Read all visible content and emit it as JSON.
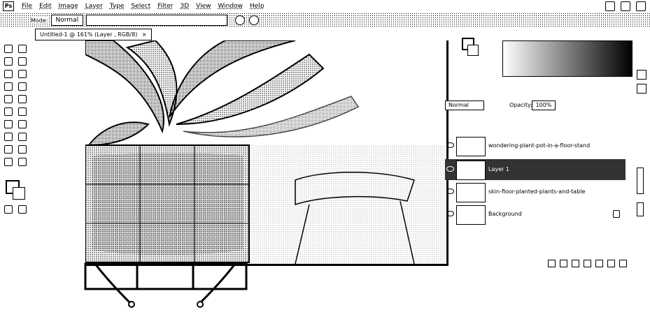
{
  "menubar": {
    "logo": "Ps",
    "items": [
      "File",
      "Edit",
      "Image",
      "Layer",
      "Type",
      "Select",
      "Filter",
      "3D",
      "View",
      "Window",
      "Help"
    ]
  },
  "options": {
    "mode_label": "Mode:",
    "mode_value": "Normal"
  },
  "document": {
    "tab_title": "Untitled-1 @ 161% (Layer , RGB/8)",
    "close": "×"
  },
  "layers": {
    "blend_mode": "Normal",
    "opacity_label": "Opacity:",
    "opacity_value": "100%",
    "items": [
      {
        "name": "wondering-plant-pot-in-a-floor-stand"
      },
      {
        "name": "Layer 1"
      },
      {
        "name": "skin-floor-planted-plants-and-table"
      },
      {
        "name": "Background"
      }
    ]
  },
  "colors": {
    "selected_layer": "#333333",
    "ink": "#000000"
  }
}
